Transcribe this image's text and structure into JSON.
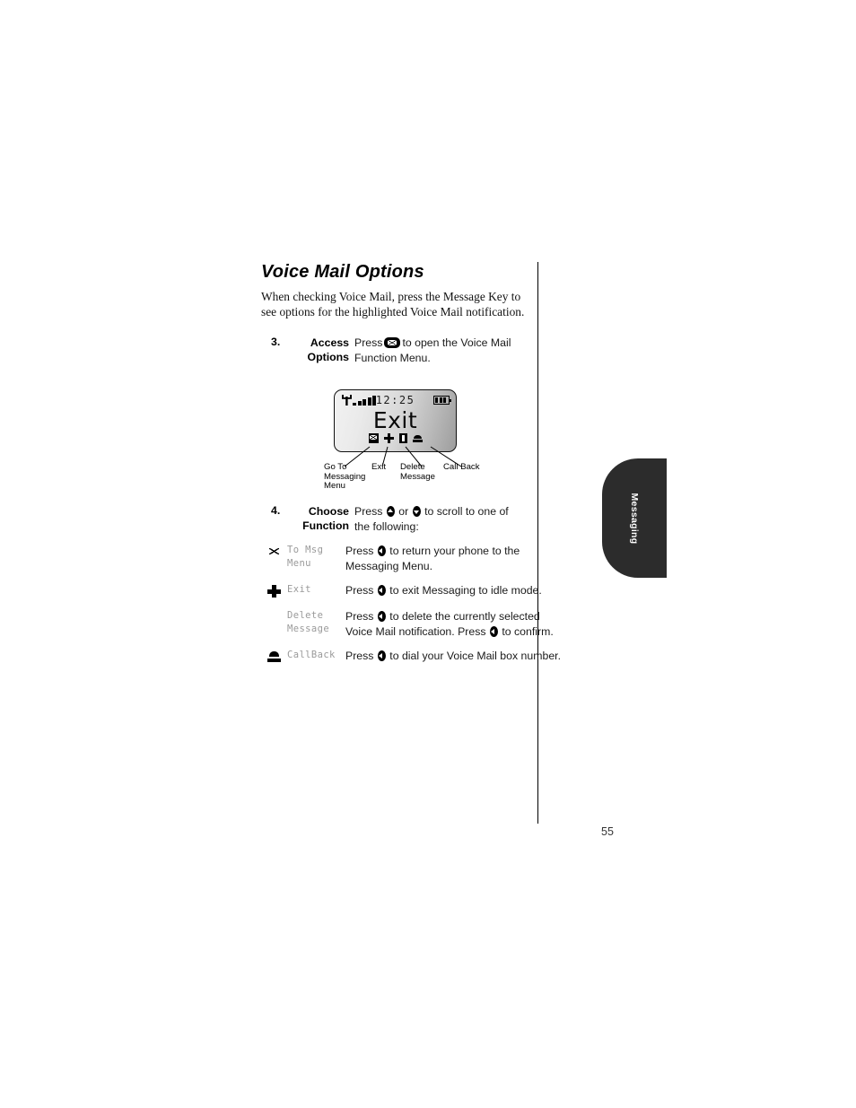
{
  "page": {
    "number": "55",
    "side_tab": "Messaging"
  },
  "heading": "Voice Mail Options",
  "intro": "When checking Voice Mail, press the Message Key to see options for the highlighted Voice Mail notification.",
  "steps": [
    {
      "number": "3.",
      "title_line1": "Access",
      "title_line2": "Options",
      "body_line1_pre": "Press",
      "body_line1_key": "message-key",
      "body_line1_post": "to open the Voice Mail",
      "body_line2": "Function Menu."
    },
    {
      "number": "4.",
      "title_line1": "Choose",
      "title_line2": "Function",
      "body_line1_pre": "Press",
      "body_line1_key1": "up-key",
      "body_line1_mid": "or",
      "body_line1_key2": "down-key",
      "body_line1_post": "to scroll to one of",
      "body_line2": "the following:"
    }
  ],
  "lcd": {
    "time": "12:25",
    "signal_bars": 5,
    "battery_level": 3,
    "main_text": "Exit",
    "soft_icons": [
      {
        "name": "envelope-icon",
        "selected": false
      },
      {
        "name": "exit-cross-icon",
        "selected": false
      },
      {
        "name": "delete-trash-icon",
        "selected": true
      },
      {
        "name": "call-back-phone-icon",
        "selected": false
      }
    ]
  },
  "callouts": [
    {
      "label_lines": [
        "Go To",
        "Messaging",
        "Menu"
      ]
    },
    {
      "label_lines": [
        "Exit"
      ]
    },
    {
      "label_lines": [
        "Delete",
        "Message"
      ]
    },
    {
      "label_lines": [
        "Call Back"
      ]
    }
  ],
  "functions": [
    {
      "icon": "envelope-icon",
      "name_lines": [
        "To Msg",
        "Menu"
      ],
      "desc_lines": [
        {
          "pre": "Press",
          "key": "select-key",
          "post": "to return your phone to the"
        },
        {
          "pre": "Messaging Menu.",
          "key": null,
          "post": ""
        }
      ]
    },
    {
      "icon": "exit-cross-icon",
      "name_lines": [
        "Exit"
      ],
      "desc_lines": [
        {
          "pre": "Press",
          "key": "select-key",
          "post": "to exit Messaging to idle mode."
        }
      ]
    },
    {
      "icon": "delete-trash-icon",
      "name_lines": [
        "Delete",
        "Message"
      ],
      "desc_lines": [
        {
          "pre": "Press",
          "key": "select-key",
          "post": "to delete the currently selected"
        },
        {
          "pre": "Voice Mail notification. Press",
          "key": "select-key",
          "post": "to confirm."
        }
      ]
    },
    {
      "icon": "call-back-phone-icon",
      "name_lines": [
        "CallBack"
      ],
      "desc_lines": [
        {
          "pre": "Press",
          "key": "select-key",
          "post": "to dial your Voice Mail box number."
        }
      ]
    }
  ]
}
